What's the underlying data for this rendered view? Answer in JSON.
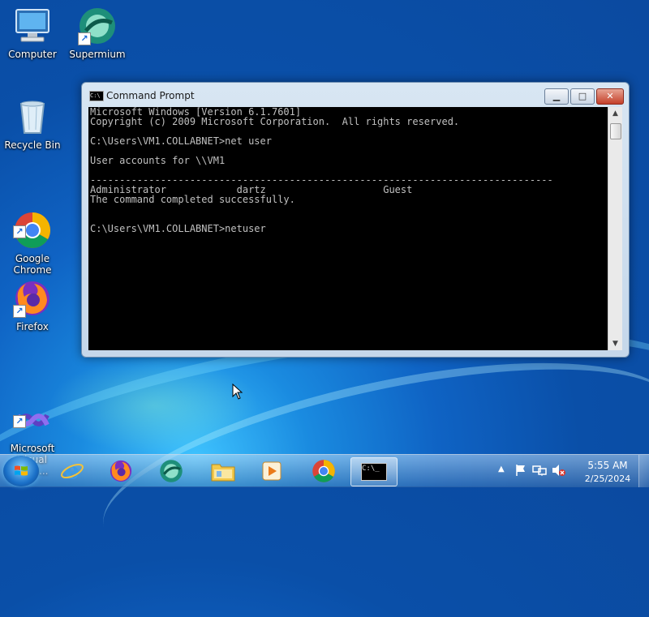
{
  "desktop": {
    "icons": [
      {
        "label": "Computer"
      },
      {
        "label": "Supermium"
      },
      {
        "label": "Recycle Bin"
      },
      {
        "label": "Google\nChrome"
      },
      {
        "label": "Firefox"
      },
      {
        "label": "Microsoft\nVisual Stud..."
      }
    ]
  },
  "window": {
    "title": "Command Prompt",
    "minimize_label": "▁",
    "maximize_label": "□",
    "close_label": "✕",
    "console_lines": [
      "Microsoft Windows [Version 6.1.7601]",
      "Copyright (c) 2009 Microsoft Corporation.  All rights reserved.",
      "",
      "C:\\Users\\VM1.COLLABNET>net user",
      "",
      "User accounts for \\\\VM1",
      "",
      "-------------------------------------------------------------------------------",
      "Administrator            dartz                    Guest",
      "The command completed successfully.",
      "",
      "",
      "C:\\Users\\VM1.COLLABNET>netuser"
    ]
  },
  "taskbar": {
    "apps": [
      {
        "name": "Internet Explorer"
      },
      {
        "name": "Firefox"
      },
      {
        "name": "Supermium"
      },
      {
        "name": "Windows Explorer"
      },
      {
        "name": "Windows Media Player"
      },
      {
        "name": "Google Chrome"
      },
      {
        "name": "Command Prompt"
      }
    ],
    "cmd_icon_text": "C:\\_",
    "tray": {
      "time": "5:55 AM",
      "date": "2/25/2024"
    }
  }
}
